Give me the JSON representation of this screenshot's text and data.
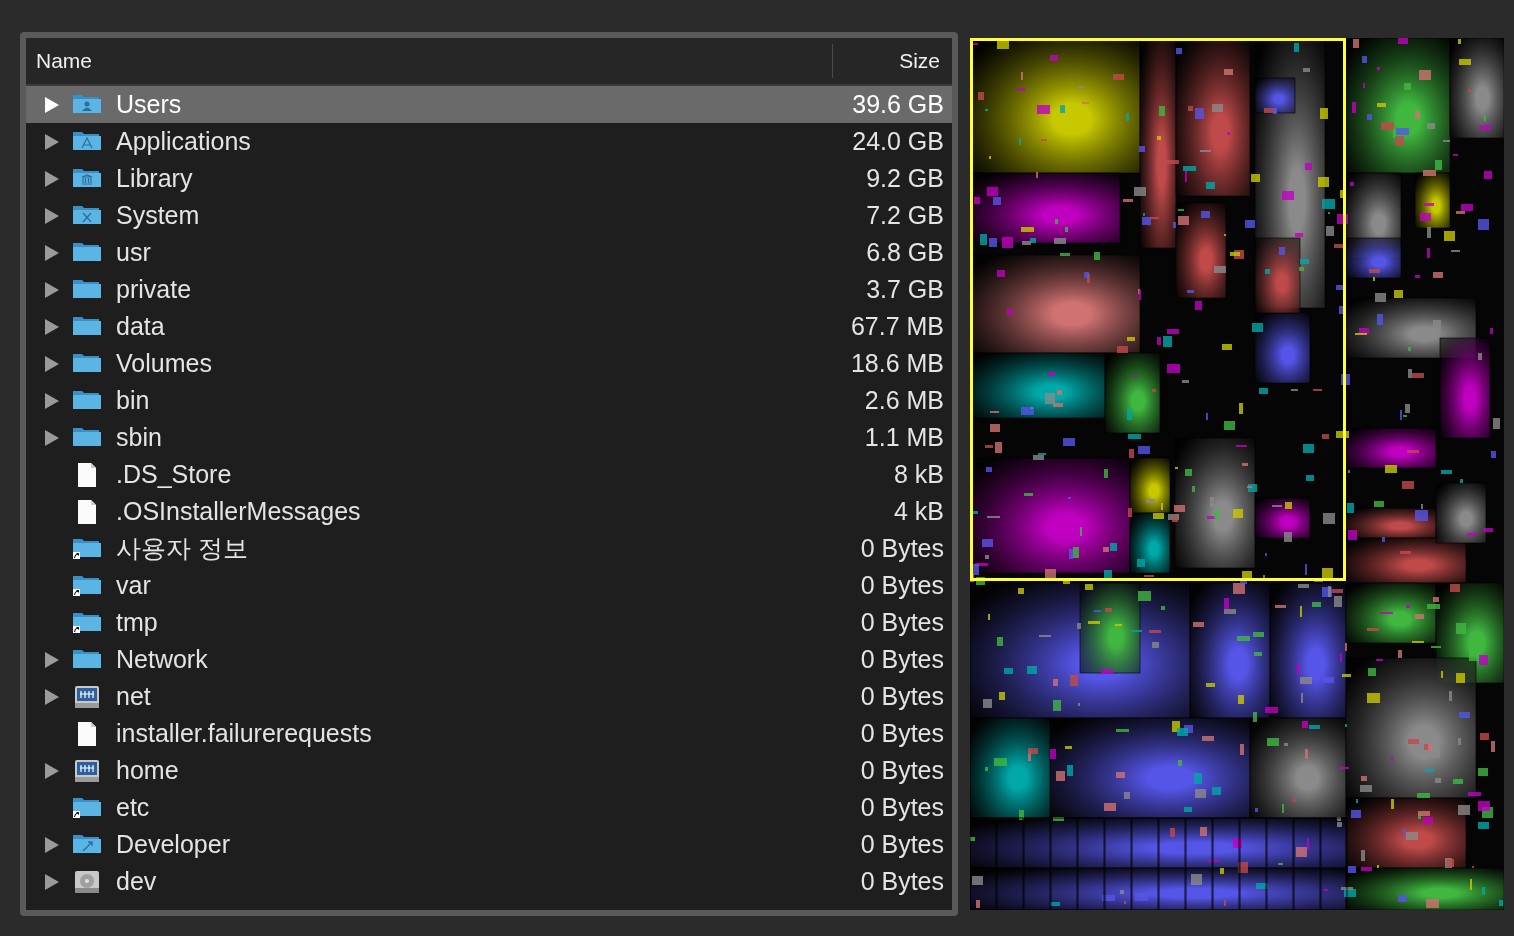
{
  "table": {
    "columns": [
      "Name",
      "Size"
    ],
    "rows": [
      {
        "name": "Users",
        "size": "39.6 GB",
        "expandable": true,
        "selected": true,
        "kind": "folder-user"
      },
      {
        "name": "Applications",
        "size": "24.0 GB",
        "expandable": true,
        "selected": false,
        "kind": "folder-apps"
      },
      {
        "name": "Library",
        "size": "9.2 GB",
        "expandable": true,
        "selected": false,
        "kind": "folder-library"
      },
      {
        "name": "System",
        "size": "7.2 GB",
        "expandable": true,
        "selected": false,
        "kind": "folder-system"
      },
      {
        "name": "usr",
        "size": "6.8 GB",
        "expandable": true,
        "selected": false,
        "kind": "folder"
      },
      {
        "name": "private",
        "size": "3.7 GB",
        "expandable": true,
        "selected": false,
        "kind": "folder"
      },
      {
        "name": "data",
        "size": "67.7 MB",
        "expandable": true,
        "selected": false,
        "kind": "folder"
      },
      {
        "name": "Volumes",
        "size": "18.6 MB",
        "expandable": true,
        "selected": false,
        "kind": "folder"
      },
      {
        "name": "bin",
        "size": "2.6 MB",
        "expandable": true,
        "selected": false,
        "kind": "folder"
      },
      {
        "name": "sbin",
        "size": "1.1 MB",
        "expandable": true,
        "selected": false,
        "kind": "folder"
      },
      {
        "name": ".DS_Store",
        "size": "8 kB",
        "expandable": false,
        "selected": false,
        "kind": "file"
      },
      {
        "name": ".OSInstallerMessages",
        "size": "4 kB",
        "expandable": false,
        "selected": false,
        "kind": "file"
      },
      {
        "name": "사용자 정보",
        "size": "0 Bytes",
        "expandable": false,
        "selected": false,
        "kind": "alias"
      },
      {
        "name": "var",
        "size": "0 Bytes",
        "expandable": false,
        "selected": false,
        "kind": "alias"
      },
      {
        "name": "tmp",
        "size": "0 Bytes",
        "expandable": false,
        "selected": false,
        "kind": "alias"
      },
      {
        "name": "Network",
        "size": "0 Bytes",
        "expandable": true,
        "selected": false,
        "kind": "folder"
      },
      {
        "name": "net",
        "size": "0 Bytes",
        "expandable": true,
        "selected": false,
        "kind": "server"
      },
      {
        "name": "installer.failurerequests",
        "size": "0 Bytes",
        "expandable": false,
        "selected": false,
        "kind": "file"
      },
      {
        "name": "home",
        "size": "0 Bytes",
        "expandable": true,
        "selected": false,
        "kind": "server"
      },
      {
        "name": "etc",
        "size": "0 Bytes",
        "expandable": false,
        "selected": false,
        "kind": "alias"
      },
      {
        "name": "Developer",
        "size": "0 Bytes",
        "expandable": true,
        "selected": false,
        "kind": "folder-dev"
      },
      {
        "name": "dev",
        "size": "0 Bytes",
        "expandable": true,
        "selected": false,
        "kind": "disk"
      }
    ]
  }
}
